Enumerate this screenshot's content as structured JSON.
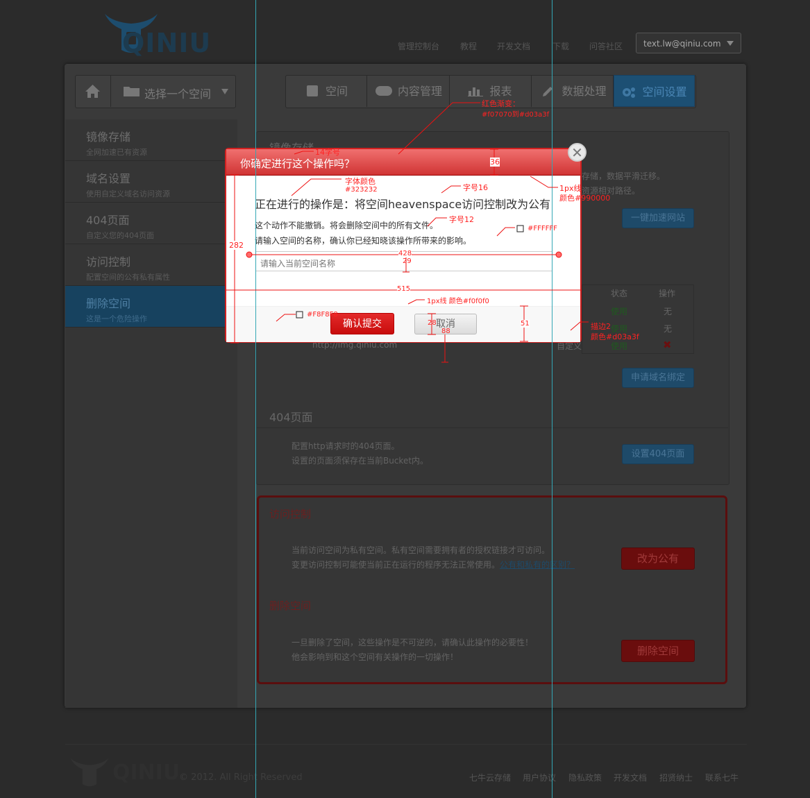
{
  "header": {
    "logo": "QINIU",
    "nav": [
      "管理控制台",
      "教程",
      "开发文档",
      "下载",
      "问答社区"
    ],
    "user": "text.lw@qiniu.com"
  },
  "toolbar": {
    "bucket_select": "选择一个空间",
    "tabs": [
      "空间",
      "内容管理",
      "报表",
      "数据处理",
      "空间设置"
    ]
  },
  "sidebar": {
    "items": [
      {
        "title": "镜像存储",
        "sub": "全网加速已有资源"
      },
      {
        "title": "域名设置",
        "sub": "使用自定义域名访问资源"
      },
      {
        "title": "404页面",
        "sub": "自定义您的404页面"
      },
      {
        "title": "访问控制",
        "sub": "配置空间的公有私有属性"
      },
      {
        "title": "删除空间",
        "sub": "这是一个危险操作"
      }
    ]
  },
  "content": {
    "mirror_title": "镜像存储",
    "mirror_text1": "存储，数据平滑迁移。",
    "mirror_text2": "资源相对路径。",
    "mirror_button": "一键加速网站",
    "domain_table": {
      "headers": [
        "状态",
        "操作"
      ],
      "rows": [
        [
          "使用",
          "无"
        ],
        [
          "使用",
          "无"
        ],
        [
          "使用",
          "✖"
        ]
      ],
      "domain_fragment": "http://img.qiniu.com",
      "custom_fragment": "自定义"
    },
    "domain_button": "申请域名绑定",
    "p404_title": "404页面",
    "p404_text1": "配置http请求时的404页面。",
    "p404_text2": "设置的页面须保存在当前Bucket内。",
    "p404_button": "设置404页面",
    "access_title": "访问控制",
    "access_text1": "当前访问空间为私有空间。私有空间需要拥有者的授权链接才可访问。",
    "access_text2": "变更访问控制可能使当前正在运行的程序无法正常使用。",
    "access_link": "公有和私有的区别？",
    "access_button": "改为公有",
    "delete_title": "删除空间",
    "delete_text1": "一旦删除了空间，这些操作是不可逆的，请确认此操作的必要性！",
    "delete_text2": "他会影响到和这个空间有关操作的一切操作！",
    "delete_button": "删除空间"
  },
  "footer": {
    "logo": "QINIU",
    "copyright": "© 2012. All Right Reserved",
    "links": [
      "七牛云存储",
      "用户协议",
      "隐私政策",
      "开发文档",
      "招贤纳士",
      "联系七牛"
    ]
  },
  "modal": {
    "title": "你确定进行这个操作吗？",
    "heading": "正在进行的操作是：将空间heavenspace访问控制改为公有",
    "line1": "这个动作不能撤销。将会删除空间中的所有文件。",
    "line2": "请输入空间的名称，确认你已经知晓该操作所带来的影响。",
    "input_placeholder": "请输入当前空间名称",
    "confirm": "确认提交",
    "cancel": "取消",
    "close": "✕"
  },
  "annotations": {
    "gradient": "红色渐变：",
    "gradient_colors": "#f07070到#d03a3f",
    "title_size": "14字号",
    "head_h": "36",
    "font_color": "字体颜色",
    "font_color_value": "#323232",
    "size16": "字号16",
    "line_1px": "1px线",
    "line_color": "颜色#990000",
    "size12": "字号12",
    "white": "#FFFFFF",
    "h282": "282",
    "w428": "428",
    "h29": "29",
    "w515": "515",
    "bg_f8": "#F8F8F8",
    "foot_line": "1px线  颜色#f0f0f0",
    "h28": "28",
    "w88": "88",
    "h51": "51",
    "stroke": "描边2",
    "stroke_color": "颜色#d03a3f"
  }
}
